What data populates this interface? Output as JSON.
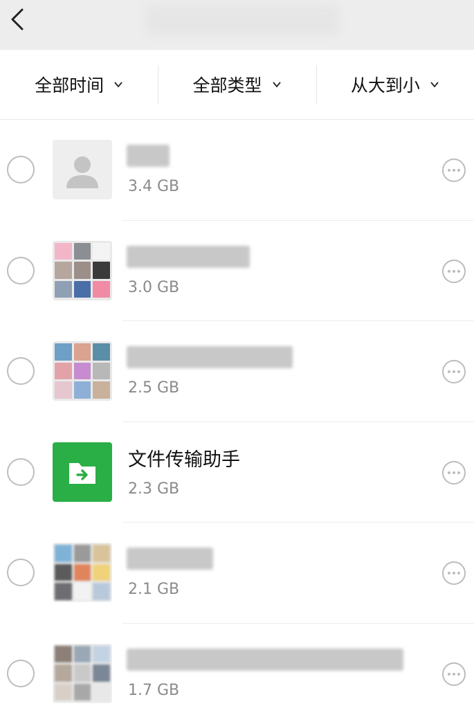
{
  "header": {
    "back_icon": "chevron-left-icon"
  },
  "filters": [
    {
      "label": "全部时间",
      "icon": "chevron-down-icon"
    },
    {
      "label": "全部类型",
      "icon": "chevron-down-icon"
    },
    {
      "label": "从大到小",
      "icon": "chevron-down-icon"
    }
  ],
  "items": [
    {
      "name": "",
      "size": "3.4 GB",
      "avatar": "default-person"
    },
    {
      "name": "",
      "size": "3.0 GB",
      "avatar": "group-grid"
    },
    {
      "name": "",
      "size": "2.5 GB",
      "avatar": "group-grid"
    },
    {
      "name": "文件传输助手",
      "size": "2.3 GB",
      "avatar": "file-transfer"
    },
    {
      "name": "",
      "size": "2.1 GB",
      "avatar": "group-grid"
    },
    {
      "name": "",
      "size": "1.7 GB",
      "avatar": "group-grid"
    }
  ],
  "colors": {
    "file_transfer_green": "#2aae46",
    "header_bg": "#ededed",
    "secondary_text": "#8a8a8a"
  }
}
